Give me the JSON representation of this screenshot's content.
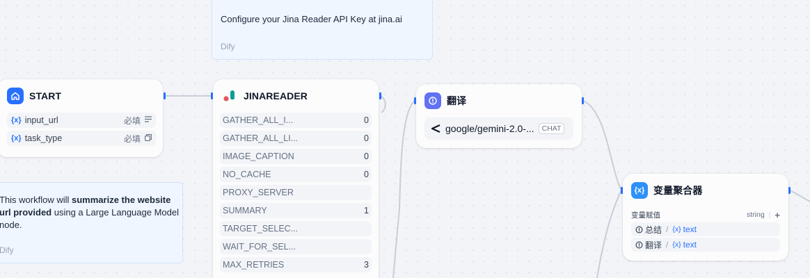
{
  "notes": [
    {
      "text_plain": "Configure your Jina Reader API Key at jina.ai",
      "author": "Dify"
    },
    {
      "text_parts": [
        {
          "t": "This workflow will ",
          "b": false
        },
        {
          "t": "summarize the website url provided",
          "b": true
        },
        {
          "t": " using a Large Language Model node.",
          "b": false
        }
      ],
      "author": "Dify"
    }
  ],
  "start": {
    "title": "START",
    "icon": "home-icon",
    "accent": "#2970ff",
    "vars": [
      {
        "x": "{x}",
        "name": "input_url",
        "required": "必填",
        "type_icon": "text-lines-icon"
      },
      {
        "x": "{x}",
        "name": "task_type",
        "required": "必填",
        "type_icon": "select-icon"
      }
    ]
  },
  "jina": {
    "title": "JINAREADER",
    "icon": "jina-logo-icon",
    "params": [
      {
        "key": "GATHER_ALL_I...",
        "value": "0"
      },
      {
        "key": "GATHER_ALL_LI...",
        "value": "0"
      },
      {
        "key": "IMAGE_CAPTION",
        "value": "0"
      },
      {
        "key": "NO_CACHE",
        "value": "0"
      },
      {
        "key": "PROXY_SERVER",
        "value": ""
      },
      {
        "key": "SUMMARY",
        "value": "1"
      },
      {
        "key": "TARGET_SELEC...",
        "value": ""
      },
      {
        "key": "WAIT_FOR_SEL...",
        "value": ""
      },
      {
        "key": "MAX_RETRIES",
        "value": "3"
      }
    ]
  },
  "translate": {
    "title": "翻译",
    "icon": "llm-icon",
    "accent": "#6172f3",
    "model": "google/gemini-2.0-...",
    "model_icon": "openrouter-icon",
    "model_badge": "CHAT"
  },
  "aggregator": {
    "title": "变量聚合器",
    "icon": "variable-x-icon",
    "accent": "#2e90fa",
    "label": "变量赋值",
    "type": "string",
    "add": "+",
    "rows": [
      {
        "source": "总结",
        "ref_x": "{x}",
        "ref": "text"
      },
      {
        "source": "翻译",
        "ref_x": "{x}",
        "ref": "text"
      }
    ]
  }
}
